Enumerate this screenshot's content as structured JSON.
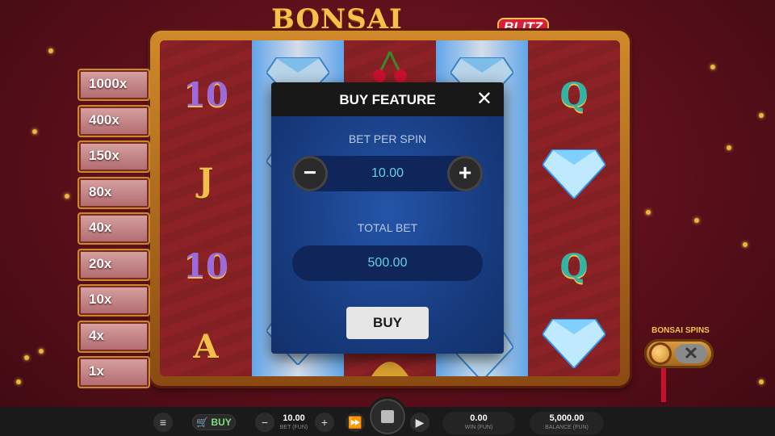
{
  "game": {
    "logo_main": "BONSAI DRAGON",
    "logo_sub": "BLITZ"
  },
  "ladder": [
    "1000x",
    "400x",
    "150x",
    "80x",
    "40x",
    "20x",
    "10x",
    "4x",
    "1x"
  ],
  "reels": {
    "reel1": [
      "10",
      "J",
      "10",
      "A"
    ],
    "reel5": [
      "Q",
      "Q"
    ]
  },
  "modal": {
    "title": "BUY FEATURE",
    "close_icon": "close-icon",
    "bet_per_spin_label": "BET PER SPIN",
    "bet_per_spin_value": "10.00",
    "minus_label": "−",
    "plus_label": "+",
    "total_bet_label": "TOTAL BET",
    "total_bet_value": "500.00",
    "buy_label": "BUY"
  },
  "bonsai_spins": {
    "label": "BONSAI SPINS",
    "off_glyph": "✕"
  },
  "bottom_bar": {
    "menu_icon": "menu-icon",
    "buy_label": "BUY",
    "bet_minus": "−",
    "bet_plus": "+",
    "bet_value": "10.00",
    "bet_caption": "BET (FUN)",
    "win_value": "0.00",
    "win_caption": "WIN (FUN)",
    "balance_value": "5,000.00",
    "balance_caption": "BALANCE (FUN)"
  },
  "colors": {
    "accent_gold": "#f6c24a",
    "background": "#5a0f1a",
    "modal_blue": "#1b3a7a",
    "value_teal": "#5fd2ea",
    "buy_green": "#7fe07f"
  }
}
